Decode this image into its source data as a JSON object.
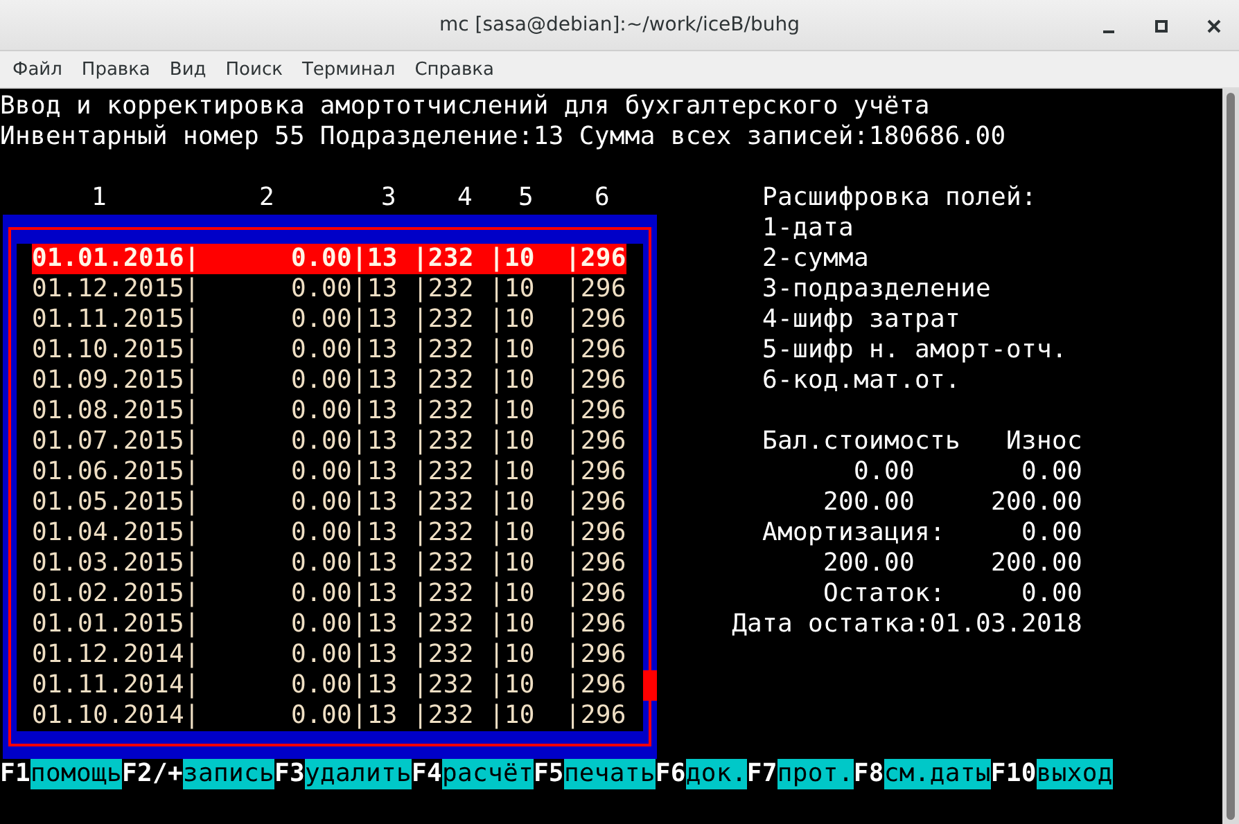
{
  "window": {
    "title": "mc [sasa@debian]:~/work/iceB/buhg"
  },
  "menu": [
    "Файл",
    "Правка",
    "Вид",
    "Поиск",
    "Терминал",
    "Справка"
  ],
  "terminal": {
    "heading": "Ввод и корректировка амортотчислений для бухгалтерского учёта",
    "info": "Инвентарный номер 55 Подразделение:13 Сумма всех записей:180686.00",
    "table": {
      "columns": [
        "1",
        "2",
        "3",
        "4",
        "5",
        "6"
      ],
      "rows": [
        {
          "text": "01.01.2016|      0.00|13 |232 |10  |296",
          "selected": true
        },
        {
          "text": "01.12.2015|      0.00|13 |232 |10  |296",
          "selected": false
        },
        {
          "text": "01.11.2015|      0.00|13 |232 |10  |296",
          "selected": false
        },
        {
          "text": "01.10.2015|      0.00|13 |232 |10  |296",
          "selected": false
        },
        {
          "text": "01.09.2015|      0.00|13 |232 |10  |296",
          "selected": false
        },
        {
          "text": "01.08.2015|      0.00|13 |232 |10  |296",
          "selected": false
        },
        {
          "text": "01.07.2015|      0.00|13 |232 |10  |296",
          "selected": false
        },
        {
          "text": "01.06.2015|      0.00|13 |232 |10  |296",
          "selected": false
        },
        {
          "text": "01.05.2015|      0.00|13 |232 |10  |296",
          "selected": false
        },
        {
          "text": "01.04.2015|      0.00|13 |232 |10  |296",
          "selected": false
        },
        {
          "text": "01.03.2015|      0.00|13 |232 |10  |296",
          "selected": false
        },
        {
          "text": "01.02.2015|      0.00|13 |232 |10  |296",
          "selected": false
        },
        {
          "text": "01.01.2015|      0.00|13 |232 |10  |296",
          "selected": false
        },
        {
          "text": "01.12.2014|      0.00|13 |232 |10  |296",
          "selected": false
        },
        {
          "text": "01.11.2014|      0.00|13 |232 |10  |296",
          "selected": false
        },
        {
          "text": "01.10.2014|      0.00|13 |232 |10  |296",
          "selected": false
        }
      ]
    },
    "legend": {
      "title": "Расшифровка полей:",
      "items": [
        "1-дата",
        "2-сумма",
        "3-подразделение",
        "4-шифр затрат",
        "5-шифр н. аморт-отч.",
        "6-код.мат.от."
      ]
    },
    "balance": [
      {
        "kind": "header",
        "label": "Бал.стоимость",
        "value": "Износ"
      },
      {
        "kind": "amounts",
        "label": "0.00",
        "value": "0.00"
      },
      {
        "kind": "amounts",
        "label": "200.00",
        "value": "200.00"
      },
      {
        "kind": "total",
        "label": "Амортизация:",
        "value": "0.00"
      },
      {
        "kind": "amounts",
        "label": "200.00",
        "value": "200.00"
      },
      {
        "kind": "total",
        "label": "Остаток:",
        "value": "0.00"
      },
      {
        "kind": "date",
        "label": "Дата остатка:01.03.2018"
      }
    ],
    "function_keys": [
      {
        "key": "F1",
        "label": "помощь"
      },
      {
        "key": "F2/+",
        "label": "запись"
      },
      {
        "key": "F3",
        "label": "удалить"
      },
      {
        "key": "F4",
        "label": "расчёт"
      },
      {
        "key": "F5",
        "label": "печать"
      },
      {
        "key": "F6",
        "label": "док."
      },
      {
        "key": "F7",
        "label": "прот."
      },
      {
        "key": "F8",
        "label": "см.даты"
      },
      {
        "key": "F10",
        "label": "выход"
      }
    ]
  }
}
